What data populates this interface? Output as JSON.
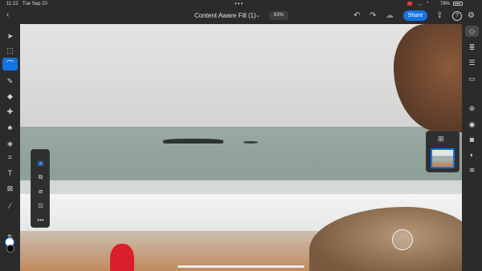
{
  "status_bar": {
    "time": "11:22",
    "date": "Tue Sep 20",
    "battery": "78%"
  },
  "toolbar": {
    "document_title": "Content Aware Fill (1)",
    "zoom": "63%",
    "share_label": "Share"
  },
  "icons": {
    "back": "‹",
    "chevron": "⌄",
    "undo": "↶",
    "redo": "↷",
    "cloud": "☁",
    "export": "⇪",
    "help": "?",
    "settings": "⚙",
    "layers_add": "⊞",
    "more": "•••"
  },
  "left_tools": [
    {
      "name": "move-tool-icon",
      "glyph": "➤"
    },
    {
      "name": "transform-tool-icon",
      "glyph": "⬚"
    },
    {
      "name": "lasso-tool-icon",
      "glyph": "⌒",
      "active": true
    },
    {
      "name": "brush-tool-icon",
      "glyph": "✎"
    },
    {
      "name": "eraser-tool-icon",
      "glyph": "◆"
    },
    {
      "name": "healing-tool-icon",
      "glyph": "✚"
    },
    {
      "name": "clone-stamp-tool-icon",
      "glyph": "♣"
    },
    {
      "name": "fill-tool-icon",
      "glyph": "◈"
    },
    {
      "name": "crop-tool-icon",
      "glyph": "⌗"
    },
    {
      "name": "type-tool-icon",
      "glyph": "T"
    },
    {
      "name": "place-image-tool-icon",
      "glyph": "⊠"
    },
    {
      "name": "eyedropper-tool-icon",
      "glyph": "⁄"
    },
    {
      "name": "adjust-tool-icon",
      "glyph": "⇅"
    }
  ],
  "right_tools": [
    {
      "name": "layers-icon",
      "glyph": "◇",
      "active": true
    },
    {
      "name": "layer-properties-icon",
      "glyph": "≣"
    },
    {
      "name": "adjustments-icon",
      "glyph": "☰"
    },
    {
      "name": "comments-icon",
      "glyph": "▭"
    },
    {
      "name": "add-layer-icon",
      "glyph": "⊕"
    },
    {
      "name": "visibility-icon",
      "glyph": "◉"
    },
    {
      "name": "mask-icon",
      "glyph": "◙"
    },
    {
      "name": "fill-icon",
      "glyph": "◐"
    },
    {
      "name": "layer-effects-icon",
      "glyph": "≋"
    }
  ],
  "selection_popover": [
    {
      "name": "selection-new-icon",
      "glyph": "▣",
      "active": true
    },
    {
      "name": "selection-add-icon",
      "glyph": "⧉"
    },
    {
      "name": "selection-subtract-icon",
      "glyph": "⧈"
    },
    {
      "name": "selection-intersect-icon",
      "glyph": "⊡"
    },
    {
      "name": "more-options-icon",
      "glyph": "•••"
    }
  ],
  "colors": {
    "accent": "#1473e6",
    "background": "#2b2b2b",
    "recording": "#e23b3b"
  }
}
